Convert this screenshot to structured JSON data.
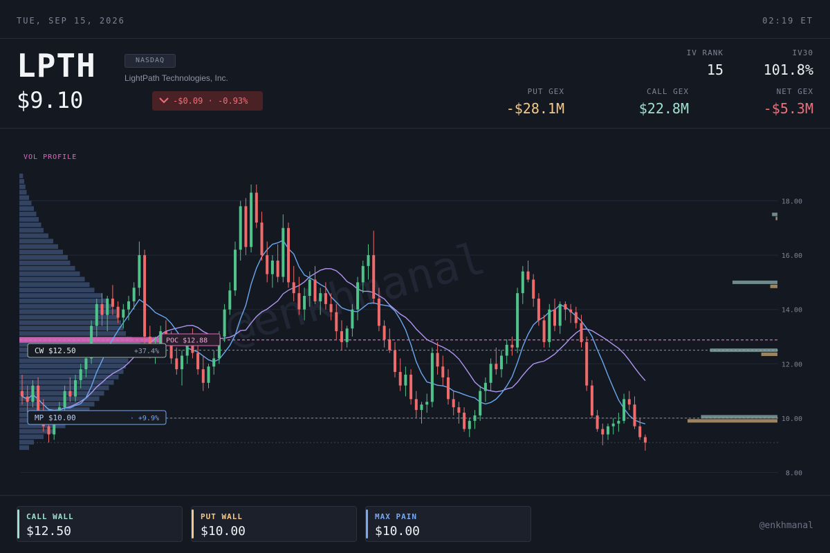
{
  "topbar": {
    "date": "TUE, SEP 15, 2026",
    "time": "02:19 ET"
  },
  "header": {
    "ticker": "LPTH",
    "price": "$9.10",
    "exchange": "NASDAQ",
    "company": "LightPath Technologies, Inc.",
    "change": "-$0.09 · -0.93%",
    "change_direction": "down",
    "iv_rank": {
      "label": "IV RANK",
      "value": "15"
    },
    "iv30": {
      "label": "IV30",
      "value": "101.8%"
    },
    "put_gex": {
      "label": "PUT GEX",
      "value": "-$28.1M",
      "color": "#f5c98a"
    },
    "call_gex": {
      "label": "CALL GEX",
      "value": "$22.8M",
      "color": "#9fe0cf"
    },
    "net_gex": {
      "label": "NET GEX",
      "value": "-$5.3M",
      "color": "#f0707a"
    }
  },
  "chart": {
    "vol_profile_label": "VOL PROFILE",
    "watermark": "@enkhmanal",
    "poc": {
      "label": "POC $12.88",
      "price": 12.88
    },
    "call_wall_tag": {
      "label": "CW $12.50",
      "change": "+37.4%",
      "price": 12.5
    },
    "max_pain_tag": {
      "label": "MP $10.00",
      "change": "· +9.9%",
      "price": 10.0
    },
    "last_price": 9.1,
    "colors": {
      "up": "#4fc38a",
      "down": "#ef6b6b",
      "ma_fast": "#6aa8f0",
      "ma_slow": "#b096f0",
      "poc": "#e06ac0",
      "profile": "#4d6a9a"
    }
  },
  "chart_data": {
    "type": "candlestick",
    "y_ticks": [
      "18.00",
      "16.00",
      "14.00",
      "12.00",
      "10.00",
      "8.00"
    ],
    "ylim": [
      7.5,
      19.5
    ],
    "candles": [
      [
        11.0,
        11.6,
        10.5,
        10.8
      ],
      [
        10.8,
        11.2,
        10.2,
        10.6
      ],
      [
        10.6,
        11.4,
        10.4,
        11.2
      ],
      [
        11.2,
        11.5,
        10.0,
        10.2
      ],
      [
        10.2,
        10.7,
        9.5,
        9.7
      ],
      [
        9.7,
        10.1,
        9.1,
        9.4
      ],
      [
        9.4,
        10.3,
        9.2,
        10.1
      ],
      [
        10.1,
        10.6,
        9.8,
        10.4
      ],
      [
        10.4,
        11.2,
        10.2,
        11.0
      ],
      [
        11.0,
        11.5,
        10.6,
        10.8
      ],
      [
        10.8,
        11.6,
        10.6,
        11.4
      ],
      [
        11.4,
        12.0,
        11.1,
        11.8
      ],
      [
        11.8,
        12.4,
        11.5,
        12.2
      ],
      [
        12.2,
        13.6,
        12.0,
        13.4
      ],
      [
        13.4,
        14.4,
        13.0,
        14.2
      ],
      [
        14.2,
        14.6,
        13.4,
        13.8
      ],
      [
        13.8,
        14.5,
        13.2,
        14.4
      ],
      [
        14.4,
        14.9,
        13.8,
        14.1
      ],
      [
        14.1,
        14.3,
        13.5,
        13.7
      ],
      [
        13.7,
        14.2,
        13.3,
        14.0
      ],
      [
        14.0,
        14.5,
        13.6,
        14.3
      ],
      [
        14.3,
        15.0,
        14.0,
        14.8
      ],
      [
        14.8,
        16.5,
        14.5,
        16.0
      ],
      [
        16.0,
        16.2,
        12.6,
        13.0
      ],
      [
        13.0,
        13.4,
        12.2,
        12.5
      ],
      [
        12.5,
        13.0,
        12.0,
        12.6
      ],
      [
        12.6,
        13.4,
        12.3,
        13.2
      ],
      [
        13.2,
        13.6,
        12.6,
        12.8
      ],
      [
        12.8,
        13.2,
        12.0,
        12.2
      ],
      [
        12.2,
        12.6,
        11.6,
        11.8
      ],
      [
        11.8,
        12.5,
        11.2,
        12.3
      ],
      [
        12.3,
        13.0,
        12.0,
        12.8
      ],
      [
        12.8,
        13.3,
        12.2,
        12.4
      ],
      [
        12.4,
        12.8,
        11.6,
        11.8
      ],
      [
        11.8,
        12.3,
        11.0,
        11.3
      ],
      [
        11.3,
        12.0,
        11.1,
        11.9
      ],
      [
        11.9,
        12.5,
        11.6,
        12.2
      ],
      [
        12.2,
        13.2,
        12.0,
        13.0
      ],
      [
        13.0,
        14.2,
        12.8,
        14.0
      ],
      [
        14.0,
        15.0,
        13.8,
        14.7
      ],
      [
        14.7,
        16.5,
        14.5,
        16.2
      ],
      [
        16.2,
        18.0,
        15.8,
        17.8
      ],
      [
        17.8,
        18.1,
        16.0,
        16.3
      ],
      [
        16.3,
        18.6,
        16.1,
        18.3
      ],
      [
        18.3,
        18.6,
        17.0,
        17.2
      ],
      [
        17.2,
        17.6,
        15.8,
        16.0
      ],
      [
        16.0,
        16.5,
        15.0,
        15.3
      ],
      [
        15.3,
        16.0,
        14.8,
        15.8
      ],
      [
        15.8,
        16.4,
        15.0,
        15.2
      ],
      [
        15.2,
        17.5,
        15.0,
        17.0
      ],
      [
        17.0,
        17.2,
        14.8,
        15.0
      ],
      [
        15.0,
        15.6,
        14.3,
        14.6
      ],
      [
        14.6,
        15.2,
        13.8,
        14.0
      ],
      [
        14.0,
        14.8,
        13.6,
        14.5
      ],
      [
        14.5,
        15.4,
        14.1,
        15.1
      ],
      [
        15.1,
        15.6,
        14.2,
        14.3
      ],
      [
        14.3,
        14.8,
        13.8,
        14.6
      ],
      [
        14.6,
        15.0,
        14.0,
        14.2
      ],
      [
        14.2,
        14.6,
        13.6,
        13.9
      ],
      [
        13.9,
        14.2,
        12.9,
        13.2
      ],
      [
        13.2,
        13.6,
        12.5,
        12.8
      ],
      [
        12.8,
        13.4,
        12.6,
        13.3
      ],
      [
        13.3,
        14.2,
        13.0,
        14.0
      ],
      [
        14.0,
        15.2,
        13.6,
        15.0
      ],
      [
        15.0,
        15.8,
        14.6,
        15.6
      ],
      [
        15.6,
        16.4,
        15.1,
        16.0
      ],
      [
        16.0,
        16.9,
        14.2,
        14.4
      ],
      [
        14.4,
        14.8,
        13.2,
        13.4
      ],
      [
        13.4,
        13.6,
        12.6,
        12.9
      ],
      [
        12.9,
        13.3,
        12.4,
        12.5
      ],
      [
        12.5,
        12.8,
        11.5,
        11.7
      ],
      [
        11.7,
        12.2,
        11.0,
        11.2
      ],
      [
        11.2,
        11.9,
        10.8,
        11.6
      ],
      [
        11.6,
        11.8,
        10.5,
        10.7
      ],
      [
        10.7,
        11.0,
        10.0,
        10.3
      ],
      [
        10.3,
        10.6,
        9.8,
        10.5
      ],
      [
        10.5,
        10.9,
        10.2,
        10.6
      ],
      [
        10.6,
        12.6,
        10.4,
        12.4
      ],
      [
        12.4,
        12.8,
        11.6,
        11.9
      ],
      [
        11.9,
        12.3,
        11.2,
        11.5
      ],
      [
        11.5,
        11.8,
        10.5,
        10.7
      ],
      [
        10.7,
        11.0,
        10.1,
        10.4
      ],
      [
        10.4,
        10.6,
        9.8,
        10.2
      ],
      [
        10.2,
        10.4,
        9.5,
        9.6
      ],
      [
        9.6,
        10.0,
        9.3,
        9.9
      ],
      [
        9.9,
        10.3,
        9.6,
        10.1
      ],
      [
        10.1,
        11.2,
        9.9,
        11.0
      ],
      [
        11.0,
        11.5,
        10.6,
        11.3
      ],
      [
        11.3,
        12.2,
        11.0,
        12.0
      ],
      [
        12.0,
        12.6,
        11.6,
        11.8
      ],
      [
        11.8,
        12.5,
        11.5,
        12.3
      ],
      [
        12.3,
        12.9,
        12.0,
        12.7
      ],
      [
        12.7,
        13.0,
        12.3,
        12.6
      ],
      [
        12.6,
        14.8,
        12.4,
        14.6
      ],
      [
        14.6,
        15.6,
        14.2,
        15.4
      ],
      [
        15.4,
        15.8,
        15.0,
        15.1
      ],
      [
        15.1,
        15.3,
        14.1,
        14.4
      ],
      [
        14.4,
        14.6,
        13.4,
        13.6
      ],
      [
        13.6,
        13.8,
        12.6,
        12.8
      ],
      [
        12.8,
        14.2,
        12.6,
        14.0
      ],
      [
        14.0,
        14.4,
        13.2,
        13.4
      ],
      [
        13.4,
        14.3,
        13.1,
        14.2
      ],
      [
        14.2,
        14.3,
        13.6,
        14.0
      ],
      [
        14.0,
        14.2,
        13.5,
        13.9
      ],
      [
        13.9,
        14.1,
        13.3,
        13.5
      ],
      [
        13.5,
        13.8,
        12.6,
        12.8
      ],
      [
        12.8,
        13.0,
        11.0,
        11.2
      ],
      [
        11.2,
        11.4,
        10.0,
        10.1
      ],
      [
        10.1,
        10.3,
        9.5,
        9.6
      ],
      [
        9.6,
        9.8,
        9.0,
        9.4
      ],
      [
        9.4,
        9.8,
        9.2,
        9.7
      ],
      [
        9.7,
        10.0,
        9.4,
        9.8
      ],
      [
        9.8,
        10.2,
        9.5,
        9.9
      ],
      [
        9.9,
        10.9,
        9.8,
        10.7
      ],
      [
        10.7,
        11.0,
        10.3,
        10.5
      ],
      [
        10.5,
        10.8,
        9.6,
        9.7
      ],
      [
        9.7,
        10.0,
        9.2,
        9.3
      ],
      [
        9.3,
        9.4,
        8.8,
        9.1
      ]
    ],
    "vol_profile_price_bins": {
      "from": 8.9,
      "to": 19.1,
      "step": 0.2
    },
    "vol_profile_weights": [
      0.08,
      0.12,
      0.2,
      0.28,
      0.38,
      0.45,
      0.52,
      0.58,
      0.62,
      0.66,
      0.7,
      0.74,
      0.78,
      0.82,
      0.86,
      0.88,
      0.9,
      0.92,
      0.95,
      1.0,
      0.93,
      0.88,
      0.86,
      0.84,
      0.82,
      0.8,
      0.76,
      0.72,
      0.68,
      0.62,
      0.58,
      0.54,
      0.5,
      0.46,
      0.42,
      0.4,
      0.36,
      0.32,
      0.28,
      0.24,
      0.2,
      0.18,
      0.16,
      0.14,
      0.12,
      0.1,
      0.08,
      0.06,
      0.05,
      0.04,
      0.03
    ],
    "gex_levels": [
      {
        "price": 17.5,
        "side": "call",
        "weight": 0.06
      },
      {
        "price": 17.35,
        "side": "put",
        "weight": 0.02
      },
      {
        "price": 15.0,
        "side": "call",
        "weight": 0.5
      },
      {
        "price": 14.85,
        "side": "put",
        "weight": 0.08
      },
      {
        "price": 12.5,
        "side": "call",
        "weight": 0.75
      },
      {
        "price": 12.35,
        "side": "put",
        "weight": 0.18
      },
      {
        "price": 10.05,
        "side": "call",
        "weight": 0.85
      },
      {
        "price": 9.9,
        "side": "put",
        "weight": 1.0
      }
    ]
  },
  "footer": {
    "cards": [
      {
        "label": "CALL WALL",
        "value": "$12.50",
        "color": "#9fe0cf"
      },
      {
        "label": "PUT WALL",
        "value": "$10.00",
        "color": "#f5c98a"
      },
      {
        "label": "MAX PAIN",
        "value": "$10.00",
        "color": "#7aa8f0"
      }
    ],
    "handle": "@enkhmanal"
  }
}
